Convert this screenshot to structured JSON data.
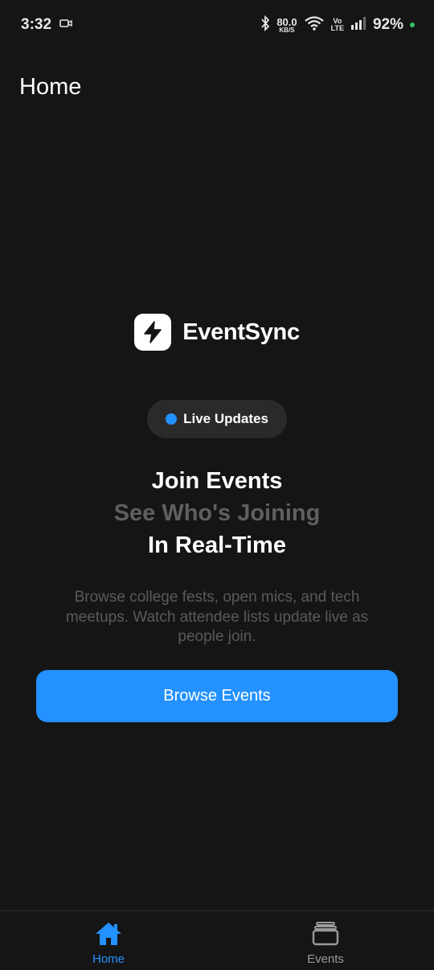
{
  "status_bar": {
    "time": "3:32",
    "net_speed_value": "80.0",
    "net_speed_unit": "KB/S",
    "volte_top": "Vo",
    "volte_bottom": "LTE",
    "battery": "92%",
    "icons": [
      "video-camera-icon",
      "bluetooth-icon",
      "wifi-icon",
      "signal-icon"
    ],
    "battery_dot_color": "#35c26a"
  },
  "header": {
    "title": "Home"
  },
  "brand": {
    "name": "EventSync",
    "logo_icon": "lightning-bolt-icon"
  },
  "live_badge": {
    "label": "Live Updates",
    "dot_color": "#2391ff"
  },
  "headline": {
    "line1": "Join Events",
    "line2": "See Who's Joining",
    "line3": "In Real-Time"
  },
  "description": "Browse college fests, open mics, and tech meetups. Watch attendee lists update live as people join.",
  "cta": {
    "label": "Browse Events",
    "color": "#2391ff"
  },
  "tabs": [
    {
      "label": "Home",
      "icon": "home-icon",
      "active": true
    },
    {
      "label": "Events",
      "icon": "stacked-cards-icon",
      "active": false
    }
  ],
  "colors": {
    "background": "#151515",
    "accent": "#2391ff",
    "muted_text": "#5a5a5a"
  }
}
